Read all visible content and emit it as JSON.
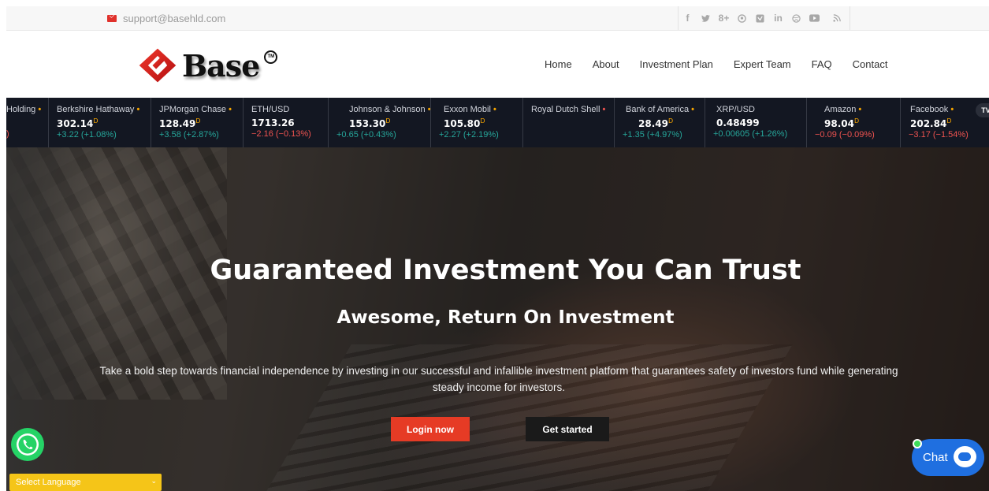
{
  "topbar": {
    "email": "support@basehld.com",
    "social": [
      "f",
      "🐦",
      "8+",
      "✿",
      "▣",
      "in",
      "⚙",
      "▶",
      "⋱"
    ]
  },
  "header": {
    "logo_text": "Base",
    "tm": "TM",
    "nav": [
      "Home",
      "About",
      "Investment Plan",
      "Expert Team",
      "FAQ",
      "Contact"
    ]
  },
  "ticker": {
    "items": [
      {
        "name": "Holding",
        "dot": "•",
        "price": "",
        "sup": "",
        "change": ")",
        "dir": "dn"
      },
      {
        "name": "Berkshire Hathaway",
        "dot": "•",
        "price": "302.14",
        "sup": "D",
        "change": "+3.22 (+1.08%)",
        "dir": "up"
      },
      {
        "name": "JPMorgan Chase",
        "dot": "•",
        "price": "128.49",
        "sup": "D",
        "change": "+3.58 (+2.87%)",
        "dir": "up"
      },
      {
        "name": "ETH/USD",
        "dot": "",
        "price": "1713.26",
        "sup": "",
        "change": "−2.16 (−0.13%)",
        "dir": "dn"
      },
      {
        "name": "Johnson & Johnson",
        "dot": "•",
        "price": "153.30",
        "sup": "D",
        "change": "+0.65 (+0.43%)",
        "dir": "up"
      },
      {
        "name": "Exxon Mobil",
        "dot": "•",
        "price": "105.80",
        "sup": "D",
        "change": "+2.27 (+2.19%)",
        "dir": "up"
      },
      {
        "name": "Royal Dutch Shell",
        "dot": "•",
        "price": "",
        "sup": "",
        "change": "",
        "dir": "up",
        "red": true
      },
      {
        "name": "Bank of America",
        "dot": "•",
        "price": "28.49",
        "sup": "D",
        "change": "+1.35 (+4.97%)",
        "dir": "up"
      },
      {
        "name": "XRP/USD",
        "dot": "",
        "price": "0.48499",
        "sup": "",
        "change": "+0.00605 (+1.26%)",
        "dir": "up"
      },
      {
        "name": "Amazon",
        "dot": "•",
        "price": "98.04",
        "sup": "D",
        "change": "−0.09 (−0.09%)",
        "dir": "dn"
      },
      {
        "name": "Facebook",
        "dot": "•",
        "price": "202.84",
        "sup": "D",
        "change": "−3.17 (−1.54%)",
        "dir": "dn"
      }
    ],
    "badge": "TV"
  },
  "hero": {
    "title": "Guaranteed Investment You Can Trust",
    "subtitle": "Awesome, Return On Investment",
    "description": "Take a bold step towards financial independence by investing in our successful and infallible investment platform that guarantees safety of investors fund while generating steady income for investors.",
    "login_label": "Login now",
    "start_label": "Get started"
  },
  "widgets": {
    "language": "Select Language",
    "chat": "Chat"
  },
  "colors": {
    "accent": "#e63b25",
    "ticker_bg": "#131722",
    "up": "#26a69a",
    "down": "#ef5350",
    "chat": "#1f6fe0",
    "language": "#f5c518"
  }
}
